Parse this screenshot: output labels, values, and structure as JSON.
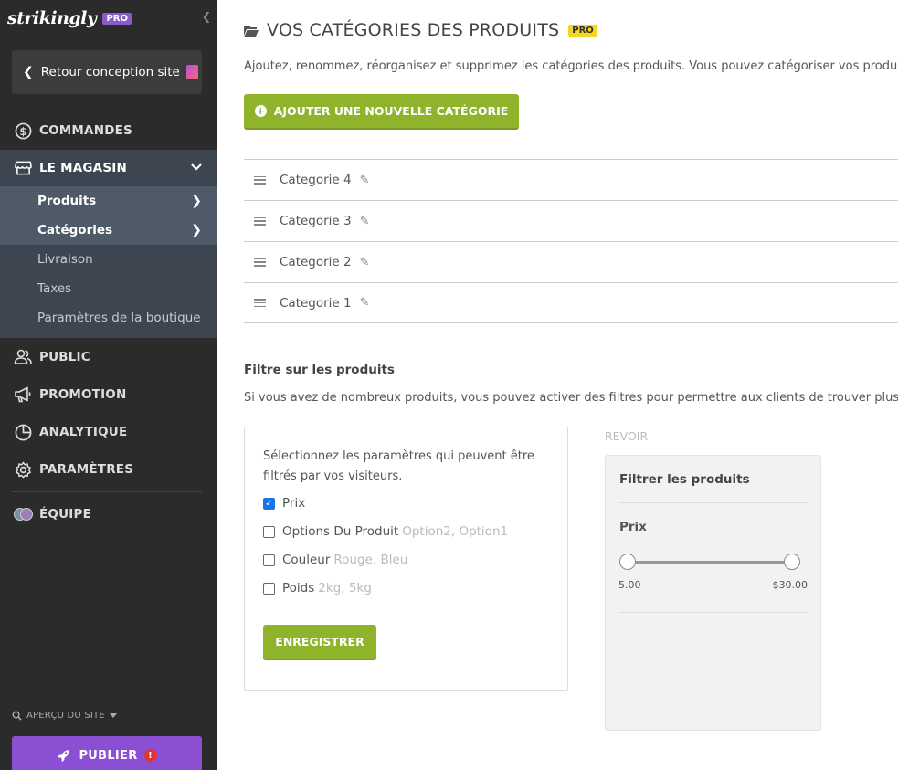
{
  "sidebar": {
    "logo": "strikingly",
    "plan_badge": "PRO",
    "back_label": "Retour conception site",
    "nav": {
      "commandes": "COMMANDES",
      "magasin": "LE MAGASIN",
      "public": "PUBLIC",
      "promotion": "PROMOTION",
      "analytique": "ANALYTIQUE",
      "parametres": "PARAMÈTRES",
      "equipe": "ÉQUIPE"
    },
    "store_sub": [
      "Produits",
      "Catégories",
      "Livraison",
      "Taxes",
      "Paramètres de la boutique"
    ],
    "preview_label": "APERÇU DU SITE",
    "publish_label": "PUBLIER",
    "publish_warning": "!",
    "accent": "#8b4fd3"
  },
  "main": {
    "title": "VOS CATÉGORIES DES PRODUITS",
    "title_badge": "PRO",
    "intro": "Ajoutez, renommez, réorganisez et supprimez les catégories des produits. Vous pouvez catégoriser vos produits",
    "add_button": "AJOUTER UNE NOUVELLE CATÉGORIE",
    "categories": [
      "Categorie 4",
      "Categorie 3",
      "Categorie 2",
      "Categorie 1"
    ],
    "filter": {
      "title": "Filtre sur les produits",
      "description": "Si vous avez de nombreux produits, vous pouvez activer des filtres pour permettre aux clients de trouver plus vite",
      "box_description": "Sélectionnez les paramètres qui peuvent être filtrés par vos visiteurs.",
      "options": [
        {
          "label": "Prix",
          "hint": "",
          "checked": true
        },
        {
          "label": "Options Du Produit",
          "hint": "Option2, Option1",
          "checked": false
        },
        {
          "label": "Couleur",
          "hint": "Rouge, Bleu",
          "checked": false
        },
        {
          "label": "Poids",
          "hint": "2kg, 5kg",
          "checked": false
        }
      ],
      "save_button": "ENREGISTRER"
    },
    "preview": {
      "label": "REVOIR",
      "title": "Filtrer les produits",
      "price_label": "Prix",
      "min": "5.00",
      "max": "$30.00"
    },
    "brand_green": "#8fb42c"
  }
}
